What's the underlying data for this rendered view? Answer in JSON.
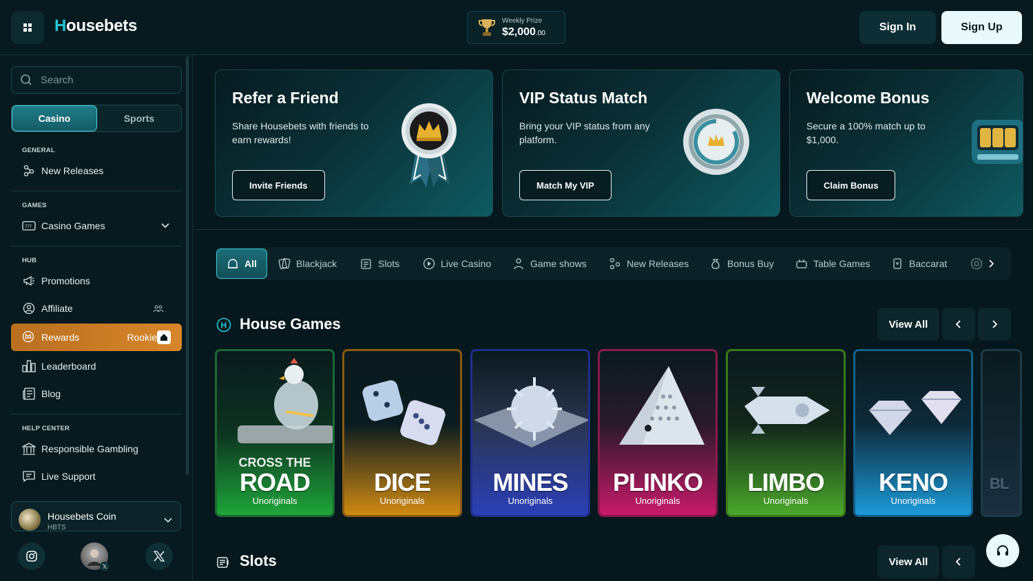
{
  "header": {
    "logo_h": "H",
    "logo_rest": "ousebets",
    "prize_label": "Weekly Prize",
    "prize_value": "$2,000",
    "prize_cents": ".00",
    "signin_label": "Sign In",
    "signup_label": "Sign Up"
  },
  "sidebar": {
    "search_placeholder": "Search",
    "toggle": [
      "Casino",
      "Sports"
    ],
    "general_heading": "GENERAL",
    "new_releases": "New Releases",
    "games_heading": "GAMES",
    "casino_games": "Casino Games",
    "hub_heading": "HUB",
    "promotions": "Promotions",
    "affiliate": "Affiliate",
    "rewards": "Rewards",
    "rewards_rank": "Rookie",
    "leaderboard": "Leaderboard",
    "blog": "Blog",
    "help_heading": "HELP CENTER",
    "responsible": "Responsible Gambling",
    "live_support": "Live Support",
    "coin_name": "Housebets Coin",
    "coin_ticker": "HBTS"
  },
  "banners": [
    {
      "title": "Refer a Friend",
      "text": "Share Housebets with friends to earn rewards!",
      "button": "Invite Friends"
    },
    {
      "title": "VIP Status Match",
      "text": "Bring your VIP status from any platform.",
      "button": "Match My VIP"
    },
    {
      "title": "Welcome Bonus",
      "text": "Secure a 100% match up to $1,000.",
      "button": "Claim Bonus"
    }
  ],
  "tabs": [
    "All",
    "Blackjack",
    "Slots",
    "Live Casino",
    "Game shows",
    "New Releases",
    "Bonus Buy",
    "Table Games",
    "Baccarat"
  ],
  "house_games": {
    "title": "House Games",
    "view_all": "View All",
    "cards": [
      {
        "pre": "CROSS THE",
        "name": "ROAD",
        "sub": "Unoriginals"
      },
      {
        "name": "DICE",
        "sub": "Unoriginals"
      },
      {
        "name": "MINES",
        "sub": "Unoriginals"
      },
      {
        "name": "PLINKO",
        "sub": "Unoriginals"
      },
      {
        "name": "LIMBO",
        "sub": "Unoriginals"
      },
      {
        "name": "KENO",
        "sub": "Unoriginals"
      },
      {
        "name": "BL"
      }
    ]
  },
  "slots": {
    "title": "Slots",
    "view_all": "View All"
  },
  "colors": {
    "accent": "#22c7da",
    "rewards": "#d8862a",
    "road": "#1fa53a",
    "dice": "#d08a12",
    "mines": "#2b3fb8",
    "plinko": "#c81a6a",
    "limbo": "#4aa82a",
    "keno": "#1c9ad8"
  }
}
